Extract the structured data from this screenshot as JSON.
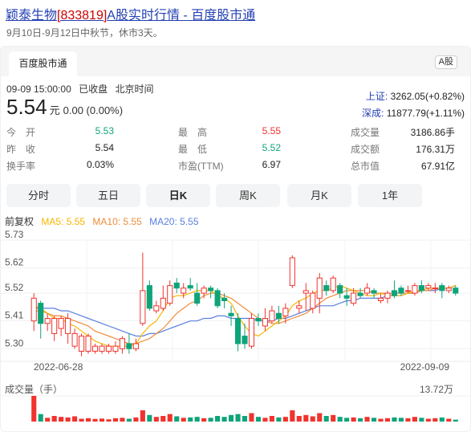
{
  "header": {
    "title_prefix": "颖泰生物",
    "title_code": "[833819]",
    "title_suffix": "A股实时行情 - 百度股市通",
    "subtitle": "9月10日-9月12日中秋节，休市3天。"
  },
  "card": {
    "tab_label": "百度股市通",
    "market_badge": "A股"
  },
  "quote": {
    "time": "09-09 15:00:00",
    "state": "已收盘",
    "timezone": "北京时间",
    "price": "5.54",
    "unit": "元",
    "change": "0.00 (0.00%)"
  },
  "indices": [
    {
      "label": "上证:",
      "value": "3262.05(+0.82%)"
    },
    {
      "label": "深成:",
      "value": "11877.79(+1.11%)"
    }
  ],
  "stats": {
    "col1": [
      {
        "key": "今　开",
        "value": "5.53",
        "color": "green"
      },
      {
        "key": "昨　收",
        "value": "5.54",
        "color": "dark"
      },
      {
        "key": "换手率",
        "value": "0.03%",
        "color": "dark"
      }
    ],
    "col2": [
      {
        "key": "最　高",
        "value": "5.55",
        "color": "red"
      },
      {
        "key": "最　低",
        "value": "5.52",
        "color": "green"
      },
      {
        "key": "市盈(TTM)",
        "value": "6.97",
        "color": "dark"
      }
    ],
    "col3": [
      {
        "key": "成交量",
        "value": "3186.86手",
        "color": "dark"
      },
      {
        "key": "成交额",
        "value": "176.31万",
        "color": "dark"
      },
      {
        "key": "总市值",
        "value": "67.91亿",
        "color": "dark"
      }
    ]
  },
  "periods": {
    "items": [
      "分时",
      "五日",
      "日K",
      "周K",
      "月K",
      "1年"
    ],
    "active_index": 2
  },
  "ma_legend": {
    "adjust": "前复权",
    "ma5": "MA5: 5.55",
    "ma10": "MA10: 5.55",
    "ma20": "MA20: 5.55"
  },
  "colors": {
    "up": "#f0332e",
    "down": "#0ea47a",
    "ma5": "#f7b500",
    "ma10": "#f08c3a",
    "ma20": "#5a7fe0"
  },
  "volume": {
    "label": "成交量（手）",
    "max_label": "13.72万"
  },
  "chart_data": {
    "type": "candlestick",
    "y_ticks": [
      "5.73",
      "5.62",
      "5.52",
      "5.41",
      "5.30"
    ],
    "ylim": [
      5.25,
      5.73
    ],
    "x_tick_labels": [
      "2022-06-28",
      "2022-09-09"
    ],
    "candles": [
      {
        "o": 5.41,
        "c": 5.5,
        "h": 5.52,
        "l": 5.37
      },
      {
        "o": 5.48,
        "c": 5.4,
        "h": 5.49,
        "l": 5.34
      },
      {
        "o": 5.4,
        "c": 5.42,
        "h": 5.44,
        "l": 5.37
      },
      {
        "o": 5.36,
        "c": 5.42,
        "h": 5.43,
        "l": 5.33
      },
      {
        "o": 5.38,
        "c": 5.42,
        "h": 5.43,
        "l": 5.35
      },
      {
        "o": 5.36,
        "c": 5.42,
        "h": 5.44,
        "l": 5.32
      },
      {
        "o": 5.31,
        "c": 5.36,
        "h": 5.38,
        "l": 5.3
      },
      {
        "o": 5.29,
        "c": 5.35,
        "h": 5.36,
        "l": 5.27
      },
      {
        "o": 5.29,
        "c": 5.35,
        "h": 5.36,
        "l": 5.28
      },
      {
        "o": 5.29,
        "c": 5.31,
        "h": 5.32,
        "l": 5.28
      },
      {
        "o": 5.29,
        "c": 5.31,
        "h": 5.32,
        "l": 5.28
      },
      {
        "o": 5.29,
        "c": 5.31,
        "h": 5.32,
        "l": 5.28
      },
      {
        "o": 5.29,
        "c": 5.31,
        "h": 5.33,
        "l": 5.28
      },
      {
        "o": 5.3,
        "c": 5.34,
        "h": 5.35,
        "l": 5.28
      },
      {
        "o": 5.32,
        "c": 5.3,
        "h": 5.36,
        "l": 5.28
      },
      {
        "o": 5.3,
        "c": 5.32,
        "h": 5.34,
        "l": 5.29
      },
      {
        "o": 5.4,
        "c": 5.53,
        "h": 5.68,
        "l": 5.39
      },
      {
        "o": 5.55,
        "c": 5.46,
        "h": 5.57,
        "l": 5.45
      },
      {
        "o": 5.45,
        "c": 5.47,
        "h": 5.49,
        "l": 5.44
      },
      {
        "o": 5.46,
        "c": 5.5,
        "h": 5.55,
        "l": 5.45
      },
      {
        "o": 5.48,
        "c": 5.55,
        "h": 5.57,
        "l": 5.47
      },
      {
        "o": 5.56,
        "c": 5.54,
        "h": 5.58,
        "l": 5.52
      },
      {
        "o": 5.52,
        "c": 5.54,
        "h": 5.56,
        "l": 5.5
      },
      {
        "o": 5.55,
        "c": 5.54,
        "h": 5.58,
        "l": 5.53
      },
      {
        "o": 5.52,
        "c": 5.48,
        "h": 5.56,
        "l": 5.47
      },
      {
        "o": 5.52,
        "c": 5.54,
        "h": 5.55,
        "l": 5.5
      },
      {
        "o": 5.54,
        "c": 5.53,
        "h": 5.55,
        "l": 5.5
      },
      {
        "o": 5.53,
        "c": 5.47,
        "h": 5.54,
        "l": 5.46
      },
      {
        "o": 5.5,
        "c": 5.49,
        "h": 5.52,
        "l": 5.46
      },
      {
        "o": 5.44,
        "c": 5.43,
        "h": 5.47,
        "l": 5.39
      },
      {
        "o": 5.42,
        "c": 5.32,
        "h": 5.44,
        "l": 5.29
      },
      {
        "o": 5.35,
        "c": 5.32,
        "h": 5.4,
        "l": 5.3
      },
      {
        "o": 5.31,
        "c": 5.42,
        "h": 5.44,
        "l": 5.3
      },
      {
        "o": 5.42,
        "c": 5.41,
        "h": 5.44,
        "l": 5.39
      },
      {
        "o": 5.39,
        "c": 5.42,
        "h": 5.46,
        "l": 5.37
      },
      {
        "o": 5.41,
        "c": 5.45,
        "h": 5.47,
        "l": 5.4
      },
      {
        "o": 5.44,
        "c": 5.42,
        "h": 5.47,
        "l": 5.4
      },
      {
        "o": 5.43,
        "c": 5.46,
        "h": 5.48,
        "l": 5.4
      },
      {
        "o": 5.55,
        "c": 5.66,
        "h": 5.67,
        "l": 5.54
      },
      {
        "o": 5.46,
        "c": 5.47,
        "h": 5.49,
        "l": 5.44
      },
      {
        "o": 5.52,
        "c": 5.53,
        "h": 5.56,
        "l": 5.45
      },
      {
        "o": 5.46,
        "c": 5.52,
        "h": 5.53,
        "l": 5.44
      },
      {
        "o": 5.5,
        "c": 5.58,
        "h": 5.6,
        "l": 5.44
      },
      {
        "o": 5.55,
        "c": 5.53,
        "h": 5.57,
        "l": 5.51
      },
      {
        "o": 5.53,
        "c": 5.58,
        "h": 5.59,
        "l": 5.52
      },
      {
        "o": 5.55,
        "c": 5.52,
        "h": 5.56,
        "l": 5.5
      },
      {
        "o": 5.51,
        "c": 5.5,
        "h": 5.54,
        "l": 5.47
      },
      {
        "o": 5.48,
        "c": 5.52,
        "h": 5.54,
        "l": 5.47
      },
      {
        "o": 5.52,
        "c": 5.51,
        "h": 5.54,
        "l": 5.5
      },
      {
        "o": 5.52,
        "c": 5.54,
        "h": 5.56,
        "l": 5.51
      },
      {
        "o": 5.53,
        "c": 5.52,
        "h": 5.54,
        "l": 5.5
      },
      {
        "o": 5.49,
        "c": 5.5,
        "h": 5.52,
        "l": 5.48
      },
      {
        "o": 5.5,
        "c": 5.52,
        "h": 5.53,
        "l": 5.48
      },
      {
        "o": 5.53,
        "c": 5.51,
        "h": 5.57,
        "l": 5.5
      },
      {
        "o": 5.54,
        "c": 5.52,
        "h": 5.55,
        "l": 5.51
      },
      {
        "o": 5.53,
        "c": 5.53,
        "h": 5.55,
        "l": 5.52
      },
      {
        "o": 5.52,
        "c": 5.55,
        "h": 5.56,
        "l": 5.51
      },
      {
        "o": 5.55,
        "c": 5.53,
        "h": 5.57,
        "l": 5.52
      },
      {
        "o": 5.54,
        "c": 5.55,
        "h": 5.56,
        "l": 5.53
      },
      {
        "o": 5.54,
        "c": 5.54,
        "h": 5.56,
        "l": 5.52
      },
      {
        "o": 5.55,
        "c": 5.53,
        "h": 5.56,
        "l": 5.5
      },
      {
        "o": 5.53,
        "c": 5.54,
        "h": 5.55,
        "l": 5.52
      },
      {
        "o": 5.54,
        "c": 5.52,
        "h": 5.55,
        "l": 5.51
      }
    ],
    "ma5": [
      5.47,
      5.46,
      5.44,
      5.42,
      5.42,
      5.4,
      5.39,
      5.37,
      5.35,
      5.33,
      5.32,
      5.31,
      5.31,
      5.31,
      5.31,
      5.32,
      5.36,
      5.39,
      5.41,
      5.45,
      5.5,
      5.51,
      5.51,
      5.52,
      5.53,
      5.53,
      5.53,
      5.51,
      5.5,
      5.48,
      5.43,
      5.39,
      5.36,
      5.35,
      5.37,
      5.39,
      5.41,
      5.43,
      5.47,
      5.49,
      5.5,
      5.52,
      5.53,
      5.53,
      5.54,
      5.55,
      5.54,
      5.53,
      5.52,
      5.51,
      5.51,
      5.52,
      5.51,
      5.51,
      5.51,
      5.52,
      5.53,
      5.53,
      5.54,
      5.54,
      5.54,
      5.54,
      5.55
    ],
    "ma10": [
      5.45,
      5.45,
      5.44,
      5.43,
      5.43,
      5.42,
      5.41,
      5.4,
      5.39,
      5.37,
      5.36,
      5.35,
      5.34,
      5.33,
      5.32,
      5.32,
      5.33,
      5.34,
      5.36,
      5.38,
      5.41,
      5.44,
      5.46,
      5.48,
      5.49,
      5.51,
      5.52,
      5.52,
      5.51,
      5.5,
      5.48,
      5.46,
      5.44,
      5.42,
      5.41,
      5.4,
      5.4,
      5.41,
      5.42,
      5.43,
      5.44,
      5.46,
      5.48,
      5.5,
      5.51,
      5.52,
      5.53,
      5.53,
      5.53,
      5.53,
      5.52,
      5.52,
      5.52,
      5.52,
      5.52,
      5.52,
      5.52,
      5.53,
      5.53,
      5.54,
      5.54,
      5.54,
      5.55
    ],
    "ma20": [
      5.46,
      5.46,
      5.46,
      5.46,
      5.45,
      5.45,
      5.44,
      5.43,
      5.42,
      5.41,
      5.4,
      5.39,
      5.38,
      5.37,
      5.36,
      5.35,
      5.35,
      5.36,
      5.36,
      5.37,
      5.38,
      5.39,
      5.4,
      5.41,
      5.41,
      5.42,
      5.42,
      5.43,
      5.43,
      5.42,
      5.42,
      5.42,
      5.42,
      5.41,
      5.41,
      5.41,
      5.42,
      5.42,
      5.43,
      5.44,
      5.45,
      5.46,
      5.47,
      5.47,
      5.47,
      5.48,
      5.49,
      5.49,
      5.5,
      5.5,
      5.5,
      5.5,
      5.51,
      5.51,
      5.51,
      5.52,
      5.52,
      5.53,
      5.53,
      5.53,
      5.54,
      5.54,
      5.55
    ],
    "volume_max": 137200,
    "volumes": [
      137200,
      40000,
      20000,
      30000,
      25000,
      22000,
      28000,
      15000,
      18000,
      14000,
      16000,
      12000,
      18000,
      20000,
      15000,
      22000,
      60000,
      35000,
      25000,
      30000,
      40000,
      28000,
      20000,
      22000,
      25000,
      18000,
      20000,
      30000,
      25000,
      35000,
      40000,
      30000,
      45000,
      25000,
      20000,
      30000,
      22000,
      25000,
      60000,
      30000,
      35000,
      28000,
      45000,
      30000,
      35000,
      25000,
      20000,
      22000,
      18000,
      25000,
      20000,
      15000,
      18000,
      22000,
      20000,
      18000,
      25000,
      20000,
      15000,
      18000,
      22000,
      15000,
      10000
    ]
  }
}
